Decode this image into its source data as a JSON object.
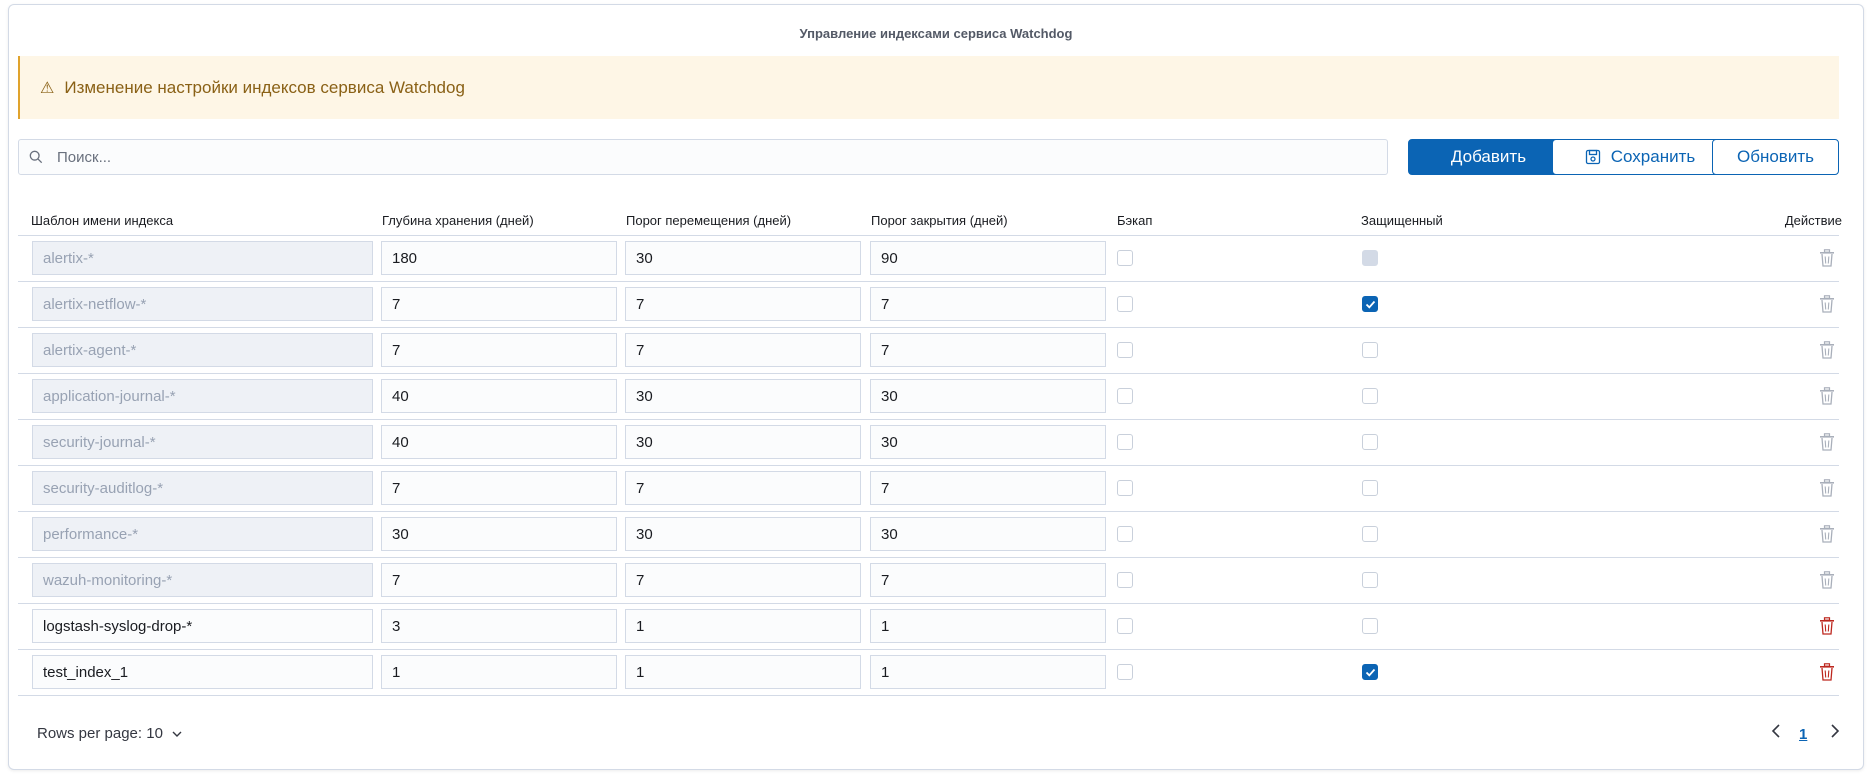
{
  "title": "Управление индексами сервиса Watchdog",
  "callout": {
    "text": "Изменение настройки индексов сервиса Watchdog",
    "icon": "warning-icon"
  },
  "search": {
    "placeholder": "Поиск...",
    "value": ""
  },
  "buttons": {
    "add": "Добавить",
    "save": "Сохранить",
    "refresh": "Обновить"
  },
  "columns": [
    "Шаблон имени индекса",
    "Глубина хранения (дней)",
    "Порог перемещения (дней)",
    "Порог закрытия (дней)",
    "Бэкап",
    "Защищенный",
    "Действие"
  ],
  "rows": [
    {
      "name": "alertix-*",
      "depth": "180",
      "move": "30",
      "close": "90",
      "backup": false,
      "protected": false,
      "protected_disabled": true,
      "locked": true
    },
    {
      "name": "alertix-netflow-*",
      "depth": "7",
      "move": "7",
      "close": "7",
      "backup": false,
      "protected": true,
      "protected_disabled": false,
      "locked": true
    },
    {
      "name": "alertix-agent-*",
      "depth": "7",
      "move": "7",
      "close": "7",
      "backup": false,
      "protected": false,
      "protected_disabled": false,
      "locked": true
    },
    {
      "name": "application-journal-*",
      "depth": "40",
      "move": "30",
      "close": "30",
      "backup": false,
      "protected": false,
      "protected_disabled": false,
      "locked": true
    },
    {
      "name": "security-journal-*",
      "depth": "40",
      "move": "30",
      "close": "30",
      "backup": false,
      "protected": false,
      "protected_disabled": false,
      "locked": true
    },
    {
      "name": "security-auditlog-*",
      "depth": "7",
      "move": "7",
      "close": "7",
      "backup": false,
      "protected": false,
      "protected_disabled": false,
      "locked": true
    },
    {
      "name": "performance-*",
      "depth": "30",
      "move": "30",
      "close": "30",
      "backup": false,
      "protected": false,
      "protected_disabled": false,
      "locked": true
    },
    {
      "name": "wazuh-monitoring-*",
      "depth": "7",
      "move": "7",
      "close": "7",
      "backup": false,
      "protected": false,
      "protected_disabled": false,
      "locked": true
    },
    {
      "name": "logstash-syslog-drop-*",
      "depth": "3",
      "move": "1",
      "close": "1",
      "backup": false,
      "protected": false,
      "protected_disabled": false,
      "locked": false
    },
    {
      "name": "test_index_1",
      "depth": "1",
      "move": "1",
      "close": "1",
      "backup": false,
      "protected": true,
      "protected_disabled": false,
      "locked": false
    }
  ],
  "pagination": {
    "rows_per_page": "Rows per page: 10",
    "current_page": "1"
  },
  "colors": {
    "primary": "#0b64b4",
    "danger": "#bd271e",
    "warning_bg": "#fef6e6",
    "warning_text": "#8a6116"
  }
}
